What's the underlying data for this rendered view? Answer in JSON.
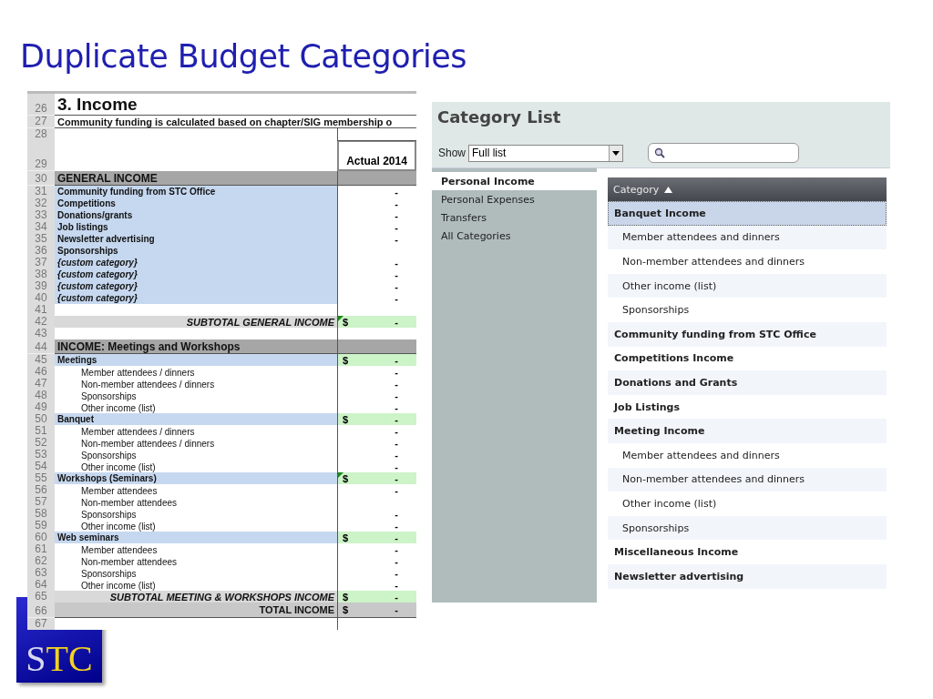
{
  "title": "Duplicate Budget Categories",
  "sheet": {
    "rows": [
      {
        "n": "26",
        "kind": "title",
        "label": "3. Income"
      },
      {
        "n": "27",
        "kind": "note",
        "label": "Community funding is calculated based on chapter/SIG membership o"
      },
      {
        "n": "28",
        "kind": "blank"
      },
      {
        "n": "29",
        "kind": "header",
        "column": "Actual 2014"
      },
      {
        "n": "30",
        "kind": "section",
        "label": "GENERAL INCOME"
      },
      {
        "n": "31",
        "kind": "item",
        "label": "Community funding from STC Office",
        "value": "-"
      },
      {
        "n": "32",
        "kind": "item",
        "label": "Competitions",
        "value": "-"
      },
      {
        "n": "33",
        "kind": "item",
        "label": "Donations/grants",
        "value": "-"
      },
      {
        "n": "34",
        "kind": "item",
        "label": "Job listings",
        "value": "-"
      },
      {
        "n": "35",
        "kind": "item",
        "label": "Newsletter advertising",
        "value": "-"
      },
      {
        "n": "36",
        "kind": "item",
        "label": "Sponsorships"
      },
      {
        "n": "37",
        "kind": "custom",
        "label": "{custom category}",
        "value": "-"
      },
      {
        "n": "38",
        "kind": "custom",
        "label": "{custom category}",
        "value": "-"
      },
      {
        "n": "39",
        "kind": "custom",
        "label": "{custom category}",
        "value": "-"
      },
      {
        "n": "40",
        "kind": "custom",
        "label": "{custom category}",
        "value": "-"
      },
      {
        "n": "41",
        "kind": "blank"
      },
      {
        "n": "42",
        "kind": "subtotal",
        "label": "SUBTOTAL GENERAL INCOME",
        "currency": "$",
        "value": "-",
        "flag": true
      },
      {
        "n": "43",
        "kind": "blank"
      },
      {
        "n": "44",
        "kind": "section",
        "label": "INCOME: Meetings and Workshops"
      },
      {
        "n": "45",
        "kind": "group",
        "label": "Meetings",
        "currency": "$",
        "value": "-"
      },
      {
        "n": "46",
        "kind": "sub",
        "label": "Member attendees / dinners",
        "value": "-"
      },
      {
        "n": "47",
        "kind": "sub",
        "label": "Non-member attendees / dinners",
        "value": "-"
      },
      {
        "n": "48",
        "kind": "sub",
        "label": "Sponsorships",
        "value": "-"
      },
      {
        "n": "49",
        "kind": "sub",
        "label": "Other income (list)",
        "value": "-"
      },
      {
        "n": "50",
        "kind": "group",
        "label": "Banquet",
        "currency": "$",
        "value": "-"
      },
      {
        "n": "51",
        "kind": "sub",
        "label": "Member attendees / dinners",
        "value": "-"
      },
      {
        "n": "52",
        "kind": "sub",
        "label": "Non-member attendees / dinners",
        "value": "-"
      },
      {
        "n": "53",
        "kind": "sub",
        "label": "Sponsorships",
        "value": "-"
      },
      {
        "n": "54",
        "kind": "sub",
        "label": "Other income (list)",
        "value": "-"
      },
      {
        "n": "55",
        "kind": "group",
        "label": "Workshops (Seminars)",
        "currency": "$",
        "value": "-",
        "flag": true
      },
      {
        "n": "56",
        "kind": "sub",
        "label": "Member attendees",
        "value": "-"
      },
      {
        "n": "57",
        "kind": "sub",
        "label": "Non-member attendees"
      },
      {
        "n": "58",
        "kind": "sub",
        "label": "Sponsorships",
        "value": "-"
      },
      {
        "n": "59",
        "kind": "sub",
        "label": "Other income (list)",
        "value": "-"
      },
      {
        "n": "60",
        "kind": "group",
        "label": "Web seminars",
        "currency": "$",
        "value": "-"
      },
      {
        "n": "61",
        "kind": "sub",
        "label": "Member attendees",
        "value": "-"
      },
      {
        "n": "62",
        "kind": "sub",
        "label": "Non-member attendees",
        "value": "-"
      },
      {
        "n": "63",
        "kind": "sub",
        "label": "Sponsorships",
        "value": "-"
      },
      {
        "n": "64",
        "kind": "sub",
        "label": "Other income (list)",
        "value": "-"
      },
      {
        "n": "65",
        "kind": "subtotal",
        "label": "SUBTOTAL MEETING & WORKSHOPS INCOME",
        "currency": "$",
        "value": "-"
      },
      {
        "n": "66",
        "kind": "total",
        "label": "TOTAL INCOME",
        "currency": "$",
        "value": "-"
      },
      {
        "n": "67",
        "kind": "blank"
      }
    ]
  },
  "category_list": {
    "title": "Category List",
    "show_label": "Show",
    "show_value": "Full list",
    "sidebar": [
      {
        "label": "Personal Income",
        "selected": true
      },
      {
        "label": "Personal Expenses",
        "selected": false
      },
      {
        "label": "Transfers",
        "selected": false
      },
      {
        "label": "All Categories",
        "selected": false
      }
    ],
    "column": "Category",
    "items": [
      {
        "kind": "parent",
        "label": "Banquet Income",
        "selected": true
      },
      {
        "kind": "child",
        "label": "Member attendees and dinners",
        "selected": false
      },
      {
        "kind": "child",
        "label": "Non-member attendees and dinners",
        "selected": false
      },
      {
        "kind": "child",
        "label": "Other income (list)",
        "selected": false
      },
      {
        "kind": "child",
        "label": "Sponsorships",
        "selected": false
      },
      {
        "kind": "parent",
        "label": "Community funding from STC Office",
        "selected": false
      },
      {
        "kind": "parent",
        "label": "Competitions Income",
        "selected": false
      },
      {
        "kind": "parent",
        "label": "Donations and Grants",
        "selected": false
      },
      {
        "kind": "parent",
        "label": "Job Listings",
        "selected": false
      },
      {
        "kind": "parent",
        "label": "Meeting Income",
        "selected": false
      },
      {
        "kind": "child",
        "label": "Member attendees and dinners",
        "selected": false
      },
      {
        "kind": "child",
        "label": "Non-member attendees and dinners",
        "selected": false
      },
      {
        "kind": "child",
        "label": "Other income (list)",
        "selected": false
      },
      {
        "kind": "child",
        "label": "Sponsorships",
        "selected": false
      },
      {
        "kind": "parent",
        "label": "Miscellaneous Income",
        "selected": false
      },
      {
        "kind": "parent",
        "label": "Newsletter advertising",
        "selected": false
      }
    ]
  },
  "logo": {
    "parts": [
      {
        "text": "S",
        "color": "#d8d8f0"
      },
      {
        "text": "TC",
        "color": "#f2d21e"
      }
    ]
  }
}
